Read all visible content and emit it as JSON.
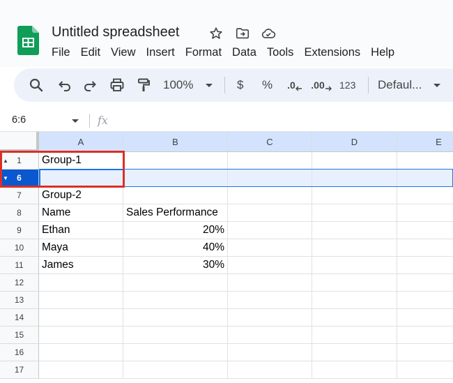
{
  "document": {
    "title": "Untitled spreadsheet"
  },
  "menu": [
    "File",
    "Edit",
    "View",
    "Insert",
    "Format",
    "Data",
    "Tools",
    "Extensions",
    "Help"
  ],
  "toolbar": {
    "zoom": "100%",
    "currency": "$",
    "percent": "%",
    "decrease_decimals": ".0",
    "increase_decimals": ".00",
    "number_format": "123",
    "font": "Defaul..."
  },
  "formula_bar": {
    "name_box": "6:6",
    "fx": "fx",
    "formula": ""
  },
  "grid": {
    "columns": [
      "A",
      "B",
      "C",
      "D",
      "E"
    ],
    "selected_row": "6",
    "rows": [
      {
        "num": "1",
        "A": "Group-1",
        "B": ""
      },
      {
        "num": "6",
        "A": "",
        "B": ""
      },
      {
        "num": "7",
        "A": "Group-2",
        "B": ""
      },
      {
        "num": "8",
        "A": "Name",
        "B": "Sales Performance"
      },
      {
        "num": "9",
        "A": "Ethan",
        "B": "20%"
      },
      {
        "num": "10",
        "A": "Maya",
        "B": "40%"
      },
      {
        "num": "11",
        "A": "James",
        "B": "30%"
      },
      {
        "num": "12",
        "A": "",
        "B": ""
      },
      {
        "num": "13",
        "A": "",
        "B": ""
      },
      {
        "num": "14",
        "A": "",
        "B": ""
      },
      {
        "num": "15",
        "A": "",
        "B": ""
      },
      {
        "num": "16",
        "A": "",
        "B": ""
      },
      {
        "num": "17",
        "A": "",
        "B": ""
      }
    ]
  },
  "colors": {
    "accent": "#1a73e8",
    "selected_header": "#0b57d0",
    "annotation": "#d93025",
    "sheets_green": "#0f9d58"
  }
}
